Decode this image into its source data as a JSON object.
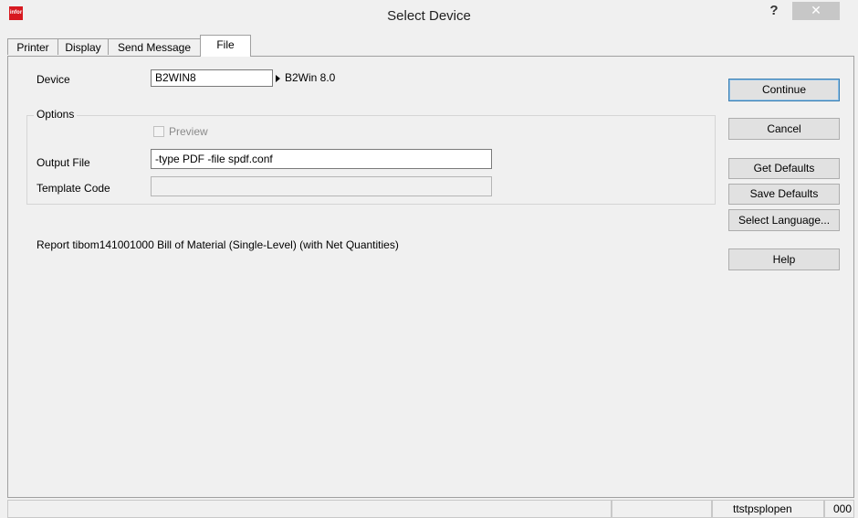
{
  "window": {
    "icon_text": "infor",
    "title": "Select Device",
    "help_glyph": "?",
    "close_glyph": "✕"
  },
  "tabs": [
    {
      "label": "Printer"
    },
    {
      "label": "Display"
    },
    {
      "label": "Send Message"
    },
    {
      "label": "File",
      "active": true
    }
  ],
  "form": {
    "device_label": "Device",
    "device_value": "B2WIN8",
    "device_description": "B2Win 8.0",
    "options_label": "Options",
    "preview_label": "Preview",
    "preview_checked": false,
    "output_file_label": "Output File",
    "output_file_value": "-type PDF -file spdf.conf",
    "template_code_label": "Template Code",
    "template_code_value": ""
  },
  "report_text": "Report tibom141001000 Bill of Material (Single-Level) (with Net Quantities)",
  "buttons": {
    "continue": "Continue",
    "cancel": "Cancel",
    "get_defaults": "Get Defaults",
    "save_defaults": "Save Defaults",
    "select_language": "Select Language...",
    "help": "Help"
  },
  "status": {
    "session": "ttstpsplopen",
    "code": "000"
  },
  "colors": {
    "brand": "#d71920",
    "default_button_border": "#3c7fb1"
  }
}
